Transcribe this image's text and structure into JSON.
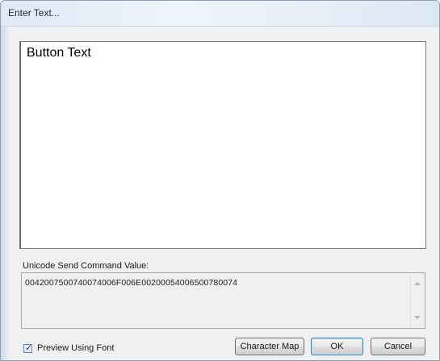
{
  "window": {
    "title": "Enter Text..."
  },
  "editor": {
    "value": "Button Text"
  },
  "unicode": {
    "label": "Unicode Send Command Value:",
    "value": "004200750074007400 6F006E0020005400650078 0074"
  },
  "preview": {
    "label": "Preview Using Font",
    "checked": true
  },
  "buttons": {
    "character_map": "Character Map",
    "ok": "OK",
    "cancel": "Cancel"
  },
  "colors": {
    "titlebar": "#dfe9f5",
    "dialog_bg": "#f0f0f0",
    "ok_border": "#3c7fb1"
  }
}
